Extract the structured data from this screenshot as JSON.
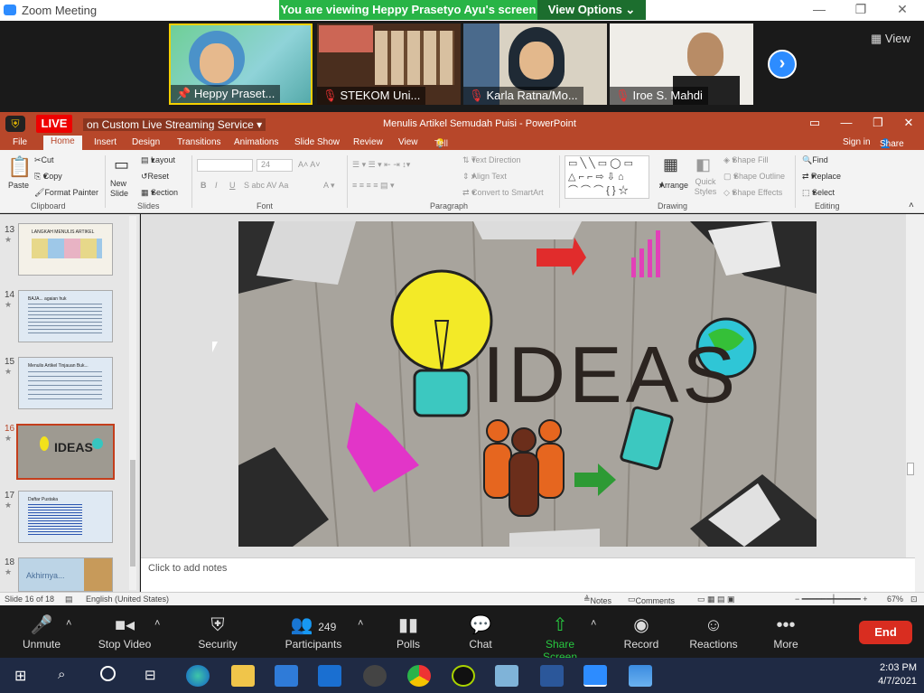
{
  "window": {
    "title": "Zoom Meeting",
    "min": "—",
    "max": "❐",
    "close": "✕"
  },
  "banner": {
    "text": "You are viewing Heppy Prasetyo Ayu's screen",
    "view_options": "View Options ⌄"
  },
  "gallery": {
    "view_label": "View",
    "participants": [
      {
        "name": "Heppy Praset..."
      },
      {
        "name": "STEKOM Uni..."
      },
      {
        "name": "Karla Ratna/Mo..."
      },
      {
        "name": "Iroe S. Mahdi"
      }
    ]
  },
  "live": {
    "badge": "LIVE",
    "service": "on Custom Live Streaming Service"
  },
  "ppt": {
    "doc_title": "Menulis Artikel Semudah Puisi - PowerPoint",
    "tabs": [
      "File",
      "Home",
      "Insert",
      "Design",
      "Transitions",
      "Animations",
      "Slide Show",
      "Review",
      "View"
    ],
    "tell": "Tell me what you want to do...",
    "signin": "Sign in",
    "share": "Share",
    "ribbon": {
      "paste": "Paste",
      "cut": "Cut",
      "copy": "Copy",
      "format_painter": "Format Painter",
      "clipboard": "Clipboard",
      "new_slide": "New Slide",
      "layout": "Layout",
      "reset": "Reset",
      "section": "Section",
      "slides": "Slides",
      "font_size": "24",
      "font": "Font",
      "paragraph": "Paragraph",
      "text_direction": "Text Direction",
      "align_text": "Align Text",
      "convert_smartart": "Convert to SmartArt",
      "arrange": "Arrange",
      "quick_styles": "Quick Styles",
      "shape_fill": "Shape Fill",
      "shape_outline": "Shape Outline",
      "shape_effects": "Shape Effects",
      "drawing": "Drawing",
      "find": "Find",
      "replace": "Replace",
      "select": "Select",
      "editing": "Editing"
    },
    "thumbs": [
      {
        "num": "13",
        "title": "LANGKAH MENULIS ARTIKEL"
      },
      {
        "num": "14",
        "title": "BAJA... agaian huk"
      },
      {
        "num": "15",
        "title": "Menulis Artikel Tinjauan Buk..."
      },
      {
        "num": "16",
        "title": "IDEAS"
      },
      {
        "num": "17",
        "title": "Daftar Pustaka"
      },
      {
        "num": "18",
        "title": "Akhirnya..."
      }
    ],
    "slide_text": "IDEAS",
    "notes_placeholder": "Click to add notes",
    "status": {
      "slide": "Slide 16 of 18",
      "lang": "English (United States)",
      "notes": "Notes",
      "comments": "Comments",
      "zoom": "67%"
    }
  },
  "zoom_toolbar": {
    "unmute": "Unmute",
    "stop_video": "Stop Video",
    "security": "Security",
    "participants": "Participants",
    "participant_count": "249",
    "polls": "Polls",
    "chat": "Chat",
    "share_screen": "Share Screen",
    "record": "Record",
    "reactions": "Reactions",
    "more": "More",
    "end": "End"
  },
  "taskbar": {
    "time": "2:03 PM",
    "date": "4/7/2021"
  }
}
